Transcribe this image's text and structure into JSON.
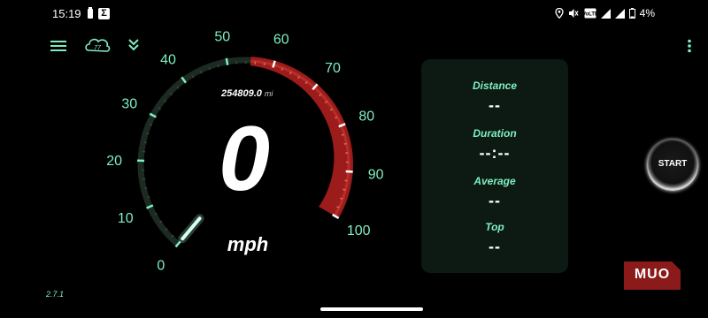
{
  "status_bar": {
    "time": "15:19",
    "left_icons": [
      "battery-saver-icon",
      "sigma-icon"
    ],
    "sigma_glyph": "Σ",
    "right_icons": [
      "location-icon",
      "mute-vibrate-icon",
      "volte-icon",
      "signal-icon",
      "signal-icon",
      "battery-icon"
    ],
    "battery_percent": "4%"
  },
  "toolbar": {
    "icons": [
      "menu-icon",
      "speedometer-logo-icon",
      "double-chevron-down-icon",
      "overflow-menu-icon"
    ],
    "logo_text": "77"
  },
  "gauge": {
    "ticks": [
      "0",
      "10",
      "20",
      "30",
      "40",
      "50",
      "60",
      "70",
      "80",
      "90",
      "100"
    ],
    "min": 0,
    "max": 100,
    "current_speed": 0,
    "speed_display": "0",
    "unit": "mph",
    "odometer": "254809.0",
    "odometer_unit": "mi",
    "redline_start": 55,
    "colors": {
      "accent": "#7df0c1",
      "track": "#1c2a22",
      "redline": "#9c1c1c",
      "redline_bright": "#c83a2f"
    }
  },
  "stats": [
    {
      "label": "Distance",
      "value": "--"
    },
    {
      "label": "Duration",
      "value": "--:--"
    },
    {
      "label": "Average",
      "value": "--"
    },
    {
      "label": "Top",
      "value": "--"
    }
  ],
  "start_button": {
    "label": "START"
  },
  "version": "2.7.1",
  "watermark": "MUO"
}
